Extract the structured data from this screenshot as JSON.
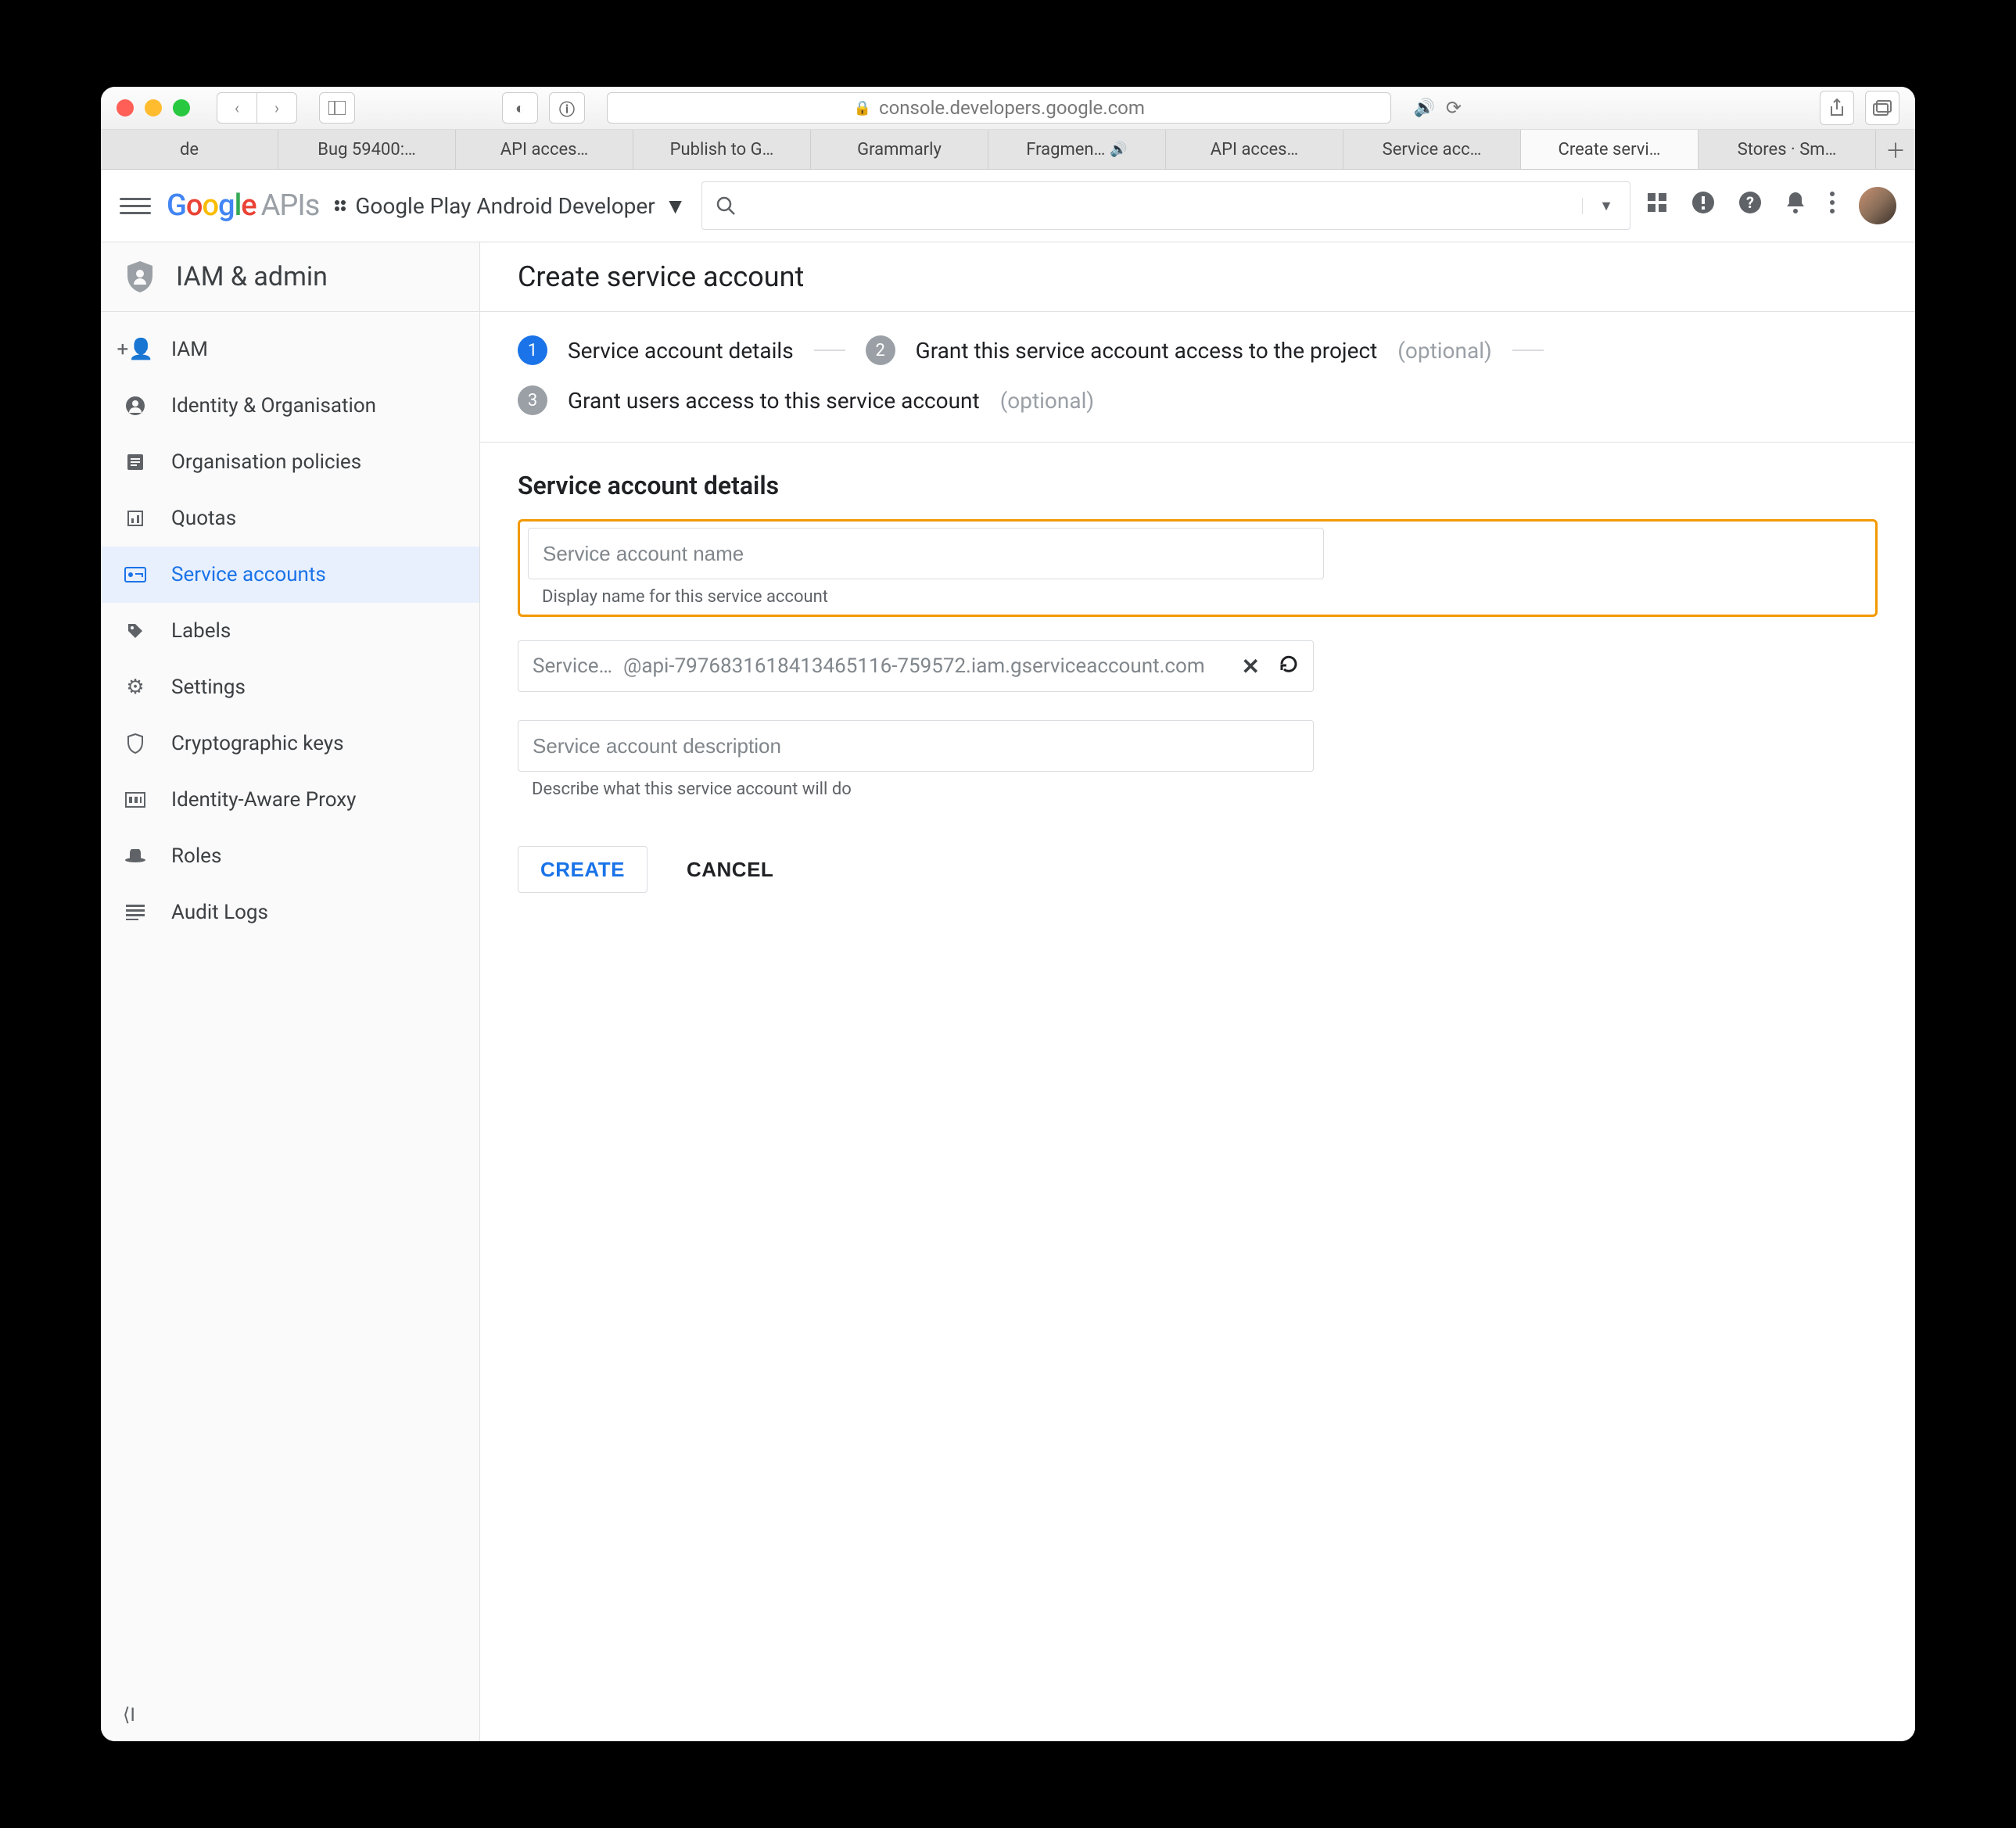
{
  "browser": {
    "url_host": "console.developers.google.com",
    "tabs": [
      "de",
      "Bug 59400:…",
      "API acces…",
      "Publish to G…",
      "Grammarly",
      "Fragmen…",
      "API acces…",
      "Service acc…",
      "Create servi…",
      "Stores · Sm…"
    ],
    "active_tab_index": 8
  },
  "topbar": {
    "logo_apis": "APIs",
    "project": "Google Play Android Developer"
  },
  "sidebar": {
    "header": "IAM & admin",
    "items": [
      {
        "icon": "person-add",
        "label": "IAM"
      },
      {
        "icon": "account-circle",
        "label": "Identity & Organisation"
      },
      {
        "icon": "list-box",
        "label": "Organisation policies"
      },
      {
        "icon": "quota",
        "label": "Quotas"
      },
      {
        "icon": "key-card",
        "label": "Service accounts"
      },
      {
        "icon": "tag",
        "label": "Labels"
      },
      {
        "icon": "gear",
        "label": "Settings"
      },
      {
        "icon": "shield",
        "label": "Cryptographic keys"
      },
      {
        "icon": "iap",
        "label": "Identity-Aware Proxy"
      },
      {
        "icon": "hat",
        "label": "Roles"
      },
      {
        "icon": "list",
        "label": "Audit Logs"
      }
    ],
    "active_index": 4
  },
  "page": {
    "title": "Create service account",
    "stepper": {
      "s1": "Service account details",
      "s2": "Grant this service account access to the project",
      "s3": "Grant users access to this service account",
      "optional": "(optional)"
    },
    "section_title": "Service account details",
    "name_placeholder": "Service account name",
    "name_help": "Display name for this service account",
    "email_prefix": "Service…",
    "email_domain": "@api-7976831618413465116-759572.iam.gserviceaccount.com",
    "desc_placeholder": "Service account description",
    "desc_help": "Describe what this service account will do",
    "btn_create": "CREATE",
    "btn_cancel": "CANCEL"
  }
}
